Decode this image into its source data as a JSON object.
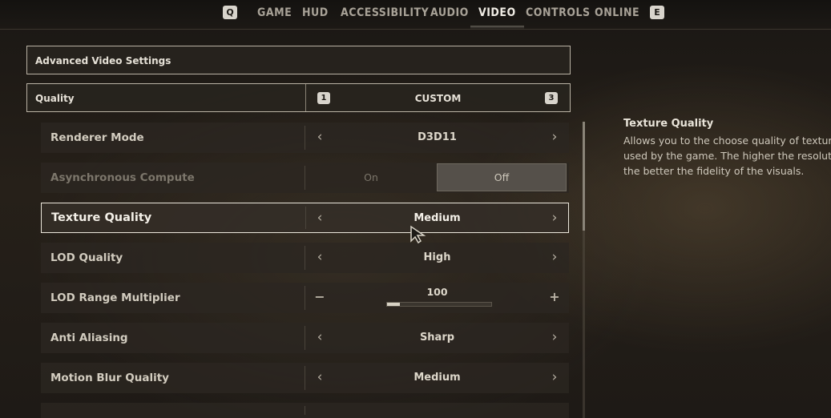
{
  "nav": {
    "left_key": "Q",
    "right_key": "E",
    "tabs": [
      "GAME",
      "HUD",
      "ACCESSIBILITY",
      "AUDIO",
      "VIDEO",
      "CONTROLS",
      "ONLINE"
    ],
    "active_tab": "VIDEO"
  },
  "section": {
    "title": "Advanced Video Settings"
  },
  "quality": {
    "label": "Quality",
    "prev_key": "1",
    "next_key": "3",
    "value": "CUSTOM"
  },
  "settings": [
    {
      "label": "Renderer Mode",
      "value": "D3D11"
    },
    {
      "label": "Asynchronous Compute",
      "on_label": "On",
      "off_label": "Off",
      "selected": "Off"
    },
    {
      "label": "Texture Quality",
      "value": "Medium"
    },
    {
      "label": "LOD Quality",
      "value": "High"
    },
    {
      "label": "LOD Range Multiplier",
      "value": "100",
      "slider_fraction": 0.12,
      "minus": "−",
      "plus": "+"
    },
    {
      "label": "Anti Aliasing",
      "value": "Sharp"
    },
    {
      "label": "Motion Blur Quality",
      "value": "Medium"
    }
  ],
  "description": {
    "title": "Texture Quality",
    "body": "Allows you to the choose quality of textures used by the game. The higher the resolution, the better the fidelity of the visuals."
  },
  "icons": {
    "prev": "chevron-left-icon",
    "next": "chevron-right-icon",
    "cursor": "mouse-pointer-icon"
  }
}
